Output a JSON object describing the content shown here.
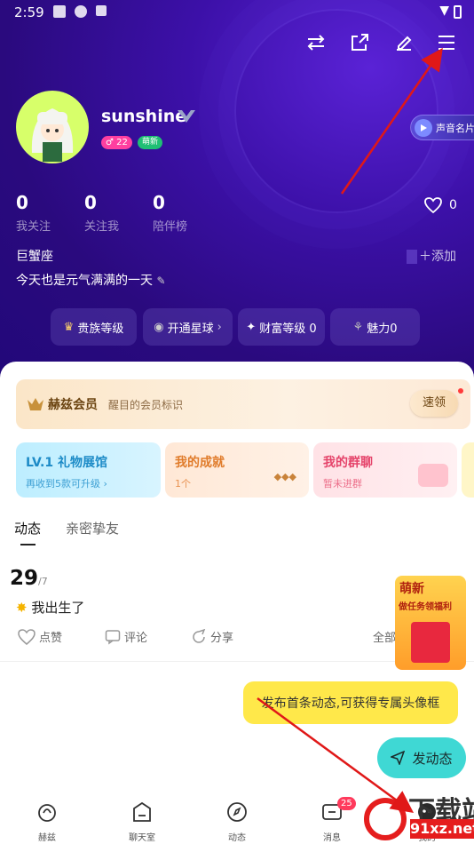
{
  "status_bar": {
    "time": "2:59"
  },
  "profile": {
    "username": "sunshine",
    "level_badge": "22",
    "new_tag": "萌新",
    "voice_card": "声音名片",
    "stats": [
      {
        "value": "0",
        "label": "我关注"
      },
      {
        "value": "0",
        "label": "关注我"
      },
      {
        "value": "0",
        "label": "陪伴榜"
      }
    ],
    "likes": "0",
    "zodiac": "巨蟹座",
    "add_tag": "添加",
    "bio": "今天也是元气满满的一天"
  },
  "pills": [
    {
      "label": "贵族等级"
    },
    {
      "label": "开通星球"
    },
    {
      "label": "财富等级 0"
    },
    {
      "label": "魅力0"
    }
  ],
  "vip": {
    "title": "赫兹会员",
    "subtitle": "醒目的会员标识",
    "button": "速领"
  },
  "cards": [
    {
      "title": "LV.1 礼物展馆",
      "subtitle": "再收到5款可升级"
    },
    {
      "title": "我的成就",
      "subtitle": "1个"
    },
    {
      "title": "我的群聊",
      "subtitle": "暂未进群"
    }
  ],
  "tabs": [
    "动态",
    "亲密挚友"
  ],
  "post": {
    "day": "29",
    "month": "/7",
    "text": "我出生了",
    "actions": [
      "点赞",
      "评论",
      "分享"
    ],
    "filter": "全部"
  },
  "promo": {
    "line1": "萌新",
    "line2": "做任务领福利"
  },
  "tip": "发布首条动态,可获得专属头像框",
  "publish_button": "发动态",
  "nav": {
    "items": [
      "赫兹",
      "聊天室",
      "动态",
      "消息",
      "我的"
    ],
    "message_badge": "25"
  },
  "watermark": {
    "line1": "下载站",
    "line2": "91xz.net"
  },
  "colors": {
    "hero_bg": "#2a0a7e",
    "accent_cyan": "#3fd8d4",
    "tip_yellow": "#ffe84a",
    "badge_red": "#ff3a5c"
  }
}
